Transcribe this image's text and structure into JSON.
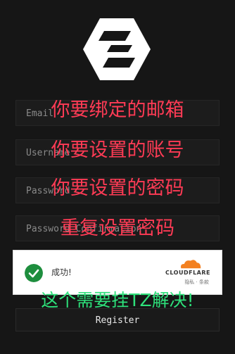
{
  "form": {
    "email_placeholder": "Email",
    "username_placeholder": "Username",
    "password_placeholder": "Password",
    "confirm_placeholder": "Password Confirmation",
    "register_label": "Register"
  },
  "captcha": {
    "status_text": "成功!",
    "brand": "CLOUDFLARE",
    "sub_links": "隐私 · 条款"
  },
  "annotations": {
    "email": "你要绑定的邮箱",
    "username": "你要设置的账号",
    "password": "你要设置的密码",
    "confirm": "重复设置密码",
    "captcha_note": "这个需要挂TZ解决!"
  },
  "colors": {
    "background": "#161616",
    "annotation_red": "#ff3b55",
    "annotation_green": "#2ee07a",
    "success_green": "#1e8e3e",
    "cloudflare_orange": "#f38020"
  },
  "icons": [
    "app-logo-icon",
    "checkmark-icon",
    "cloudflare-logo-icon"
  ]
}
